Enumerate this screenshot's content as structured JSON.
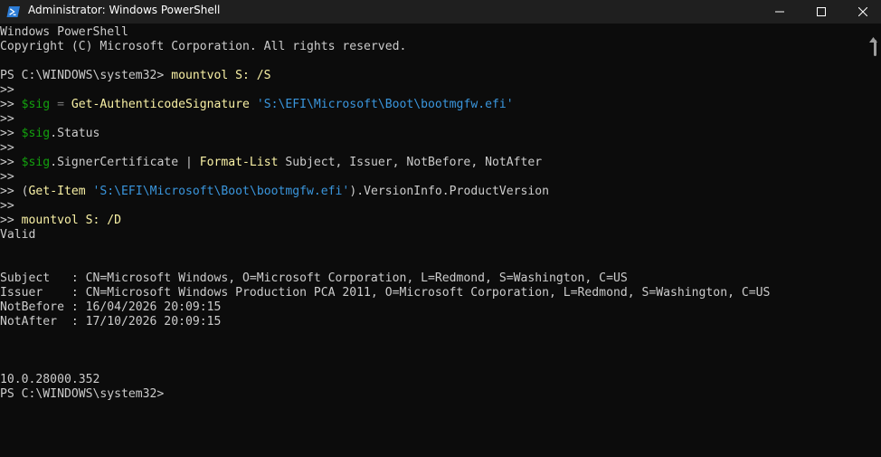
{
  "window": {
    "title": "Administrator: Windows PowerShell",
    "icon": "powershell-icon",
    "controls": [
      "minimize-icon",
      "maximize-icon",
      "close-icon"
    ]
  },
  "colors": {
    "background": "#0c0c0c",
    "titlebar": "#1f1f1f",
    "text": "#cccccc",
    "variable": "#13a10e",
    "command": "#f9f1a5",
    "string": "#3a96dd"
  },
  "console": {
    "header1": "Windows PowerShell",
    "header2": "Copyright (C) Microsoft Corporation. All rights reserved.",
    "prompt1": "PS C:\\WINDOWS\\system32> ",
    "cmd1": "mountvol S: /S",
    "cont": ">> ",
    "l5_var": "$sig",
    "l5_op": " = ",
    "l5_cmd": "Get-AuthenticodeSignature",
    "l5_sp": " ",
    "l5_str": "'S:\\EFI\\Microsoft\\Boot\\bootmgfw.efi'",
    "l7_var": "$sig",
    "l7_rest": ".Status",
    "l9_var": "$sig",
    "l9_rest": ".SignerCertificate | ",
    "l9_cmd": "Format-List",
    "l9_args": " Subject, Issuer, NotBefore, NotAfter",
    "l11_open": "(",
    "l11_cmd": "Get-Item",
    "l11_sp": " ",
    "l11_str": "'S:\\EFI\\Microsoft\\Boot\\bootmgfw.efi'",
    "l11_rest": ").VersionInfo.ProductVersion",
    "l13_cmd": "mountvol S: /D",
    "status": "Valid",
    "subject": "Subject   : CN=Microsoft Windows, O=Microsoft Corporation, L=Redmond, S=Washington, C=US",
    "issuer": "Issuer    : CN=Microsoft Windows Production PCA 2011, O=Microsoft Corporation, L=Redmond, S=Washington, C=US",
    "notbefore": "NotBefore : 16/04/2026 20:09:15",
    "notafter": "NotAfter  : 17/10/2026 20:09:15",
    "version": "10.0.28000.352",
    "prompt2": "PS C:\\WINDOWS\\system32>"
  }
}
